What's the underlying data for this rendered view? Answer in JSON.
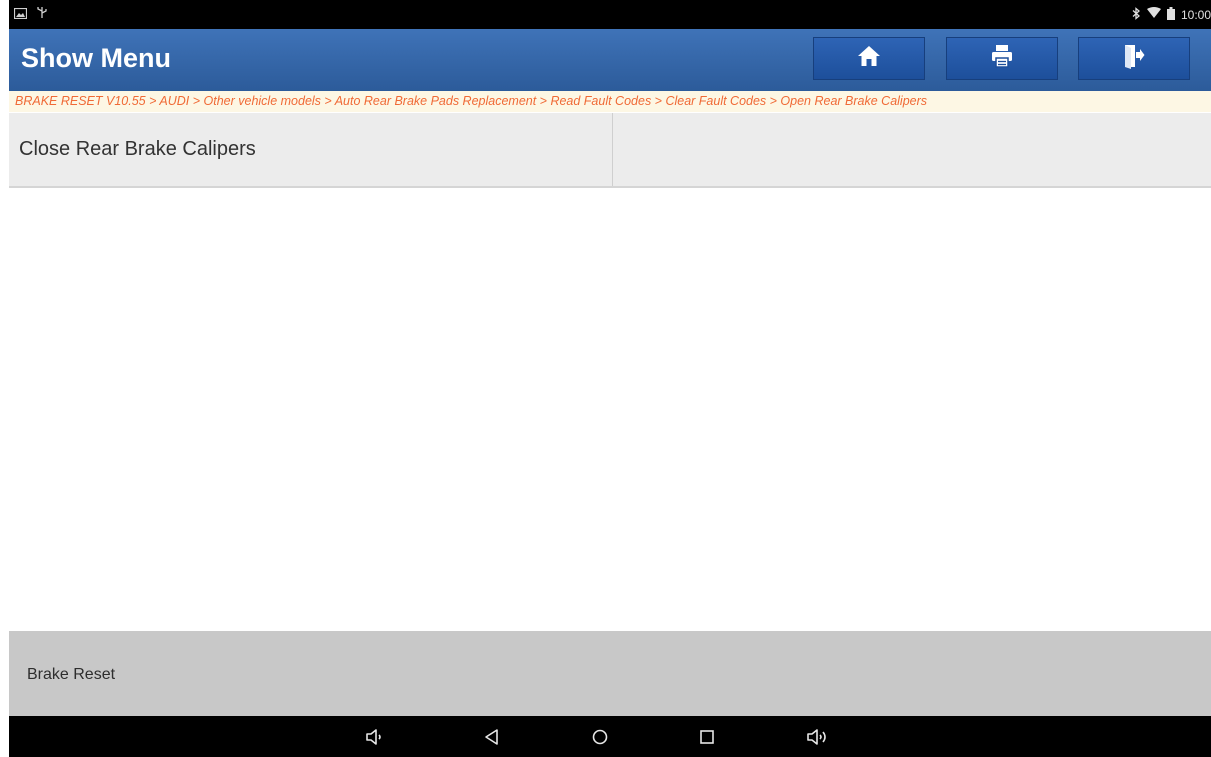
{
  "status_bar": {
    "time": "10:00",
    "icons": [
      "image-icon",
      "usb-icon",
      "bluetooth-icon",
      "wifi-icon",
      "battery-icon"
    ]
  },
  "header": {
    "title": "Show Menu",
    "buttons": [
      "home-icon",
      "print-icon",
      "exit-icon"
    ],
    "colors": {
      "bar": "#2c5b9a",
      "button": "#1d4f9b"
    }
  },
  "breadcrumb": {
    "text": "BRAKE RESET V10.55 > AUDI > Other vehicle models > Auto Rear Brake Pads Replacement > Read Fault Codes > Clear Fault Codes > Open Rear Brake Calipers",
    "color": "#f06a36"
  },
  "menu": {
    "items": [
      {
        "label": "Close Rear Brake Calipers"
      },
      {
        "label": ""
      }
    ]
  },
  "footer": {
    "label": "Brake Reset"
  },
  "nav_bar": {
    "icons": [
      "volume-down-icon",
      "back-icon",
      "home-circle-icon",
      "recents-icon",
      "volume-up-icon"
    ]
  }
}
